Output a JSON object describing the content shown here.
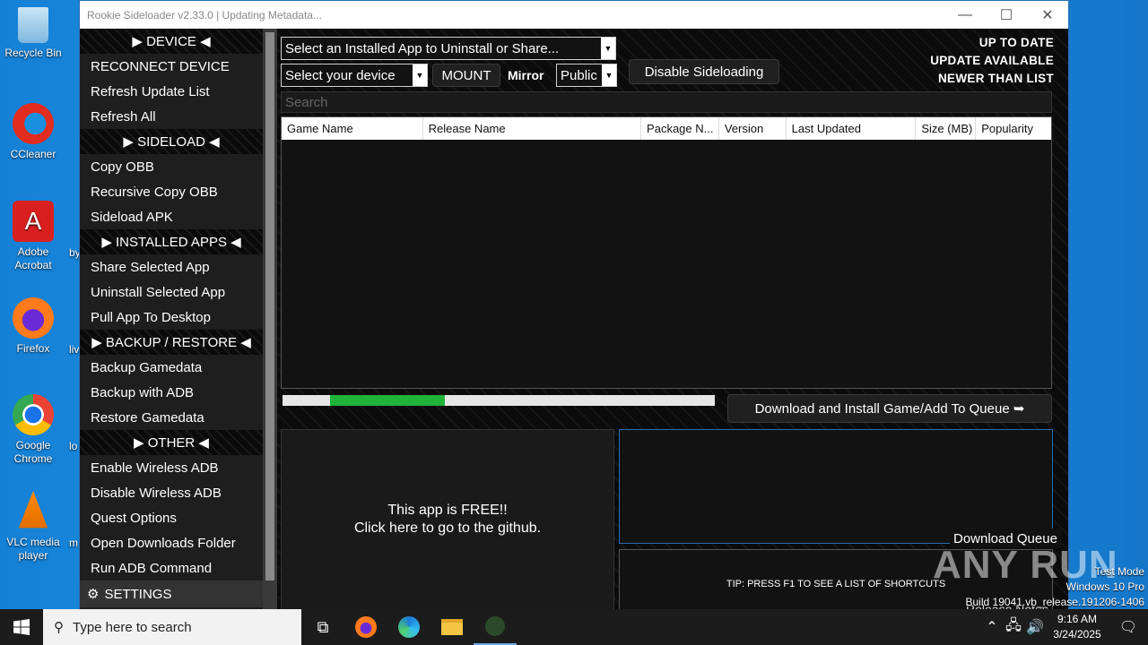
{
  "desktop": {
    "icons": [
      {
        "label": "Recycle Bin",
        "icon": "recycle-bin-icon"
      },
      {
        "label": "CCleaner",
        "icon": "ccleaner-icon"
      },
      {
        "label": "Adobe Acrobat",
        "icon": "acrobat-icon"
      },
      {
        "label": "Firefox",
        "icon": "firefox-icon"
      },
      {
        "label": "Google Chrome",
        "icon": "chrome-icon"
      },
      {
        "label": "VLC media player",
        "icon": "vlc-icon"
      }
    ],
    "cut_labels": [
      "by",
      "liv",
      "lo",
      "m"
    ]
  },
  "window": {
    "title": "Rookie Sideloader v2.33.0 | Updating Metadata...",
    "minimize": "—",
    "maximize": "☐",
    "close": "✕"
  },
  "sidebar": {
    "device_header": "DEVICE",
    "device_items": [
      "RECONNECT DEVICE",
      "Refresh Update List",
      "Refresh All"
    ],
    "sideload_header": "SIDELOAD",
    "sideload_items": [
      "Copy OBB",
      "Recursive Copy OBB",
      "Sideload APK"
    ],
    "installed_header": "INSTALLED APPS",
    "installed_items": [
      "Share Selected App",
      "Uninstall Selected App",
      "Pull App To Desktop"
    ],
    "backup_header": "BACKUP / RESTORE",
    "backup_items": [
      "Backup Gamedata",
      "Backup with ADB",
      "Restore Gamedata"
    ],
    "other_header": "OTHER",
    "other_items": [
      "Enable Wireless ADB",
      "Disable Wireless ADB",
      "Quest Options",
      "Open Downloads Folder",
      "Run ADB Command"
    ],
    "settings": "SETTINGS"
  },
  "toolbar": {
    "installed_select": "Select an Installed App to Uninstall or Share...",
    "device_select": "Select your device",
    "mount": "MOUNT",
    "mirror_label": "Mirror",
    "mirror_value": "Public",
    "disable_sideloading": "Disable Sideloading"
  },
  "status": [
    "UP TO DATE",
    "UPDATE AVAILABLE",
    "NEWER THAN LIST"
  ],
  "search": {
    "placeholder": "Search"
  },
  "grid": {
    "columns": [
      "Game Name",
      "Release Name",
      "Package N...",
      "Version",
      "Last Updated",
      "Size (MB)",
      "Popularity"
    ]
  },
  "progress": {
    "start": 0.11,
    "end": 0.375
  },
  "download_button": "Download and Install Game/Add To Queue ➥",
  "free_line1": "This app is FREE!!",
  "free_line2": "Click here to go to the github.",
  "queue_label": "Download Queue",
  "tip": "TIP: PRESS F1 TO SEE A LIST OF SHORTCUTS",
  "release_notes": "Release Notes",
  "version_tail": "2.33.0",
  "watermark": "ANY RUN",
  "os_info": [
    "Test Mode",
    "Windows 10 Pro",
    "Build 19041.vb_release.191206-1406"
  ],
  "taskbar": {
    "search_placeholder": "Type here to search",
    "behind_text": "Updating Metadata...",
    "time": "9:16 AM",
    "date": "3/24/2025"
  }
}
